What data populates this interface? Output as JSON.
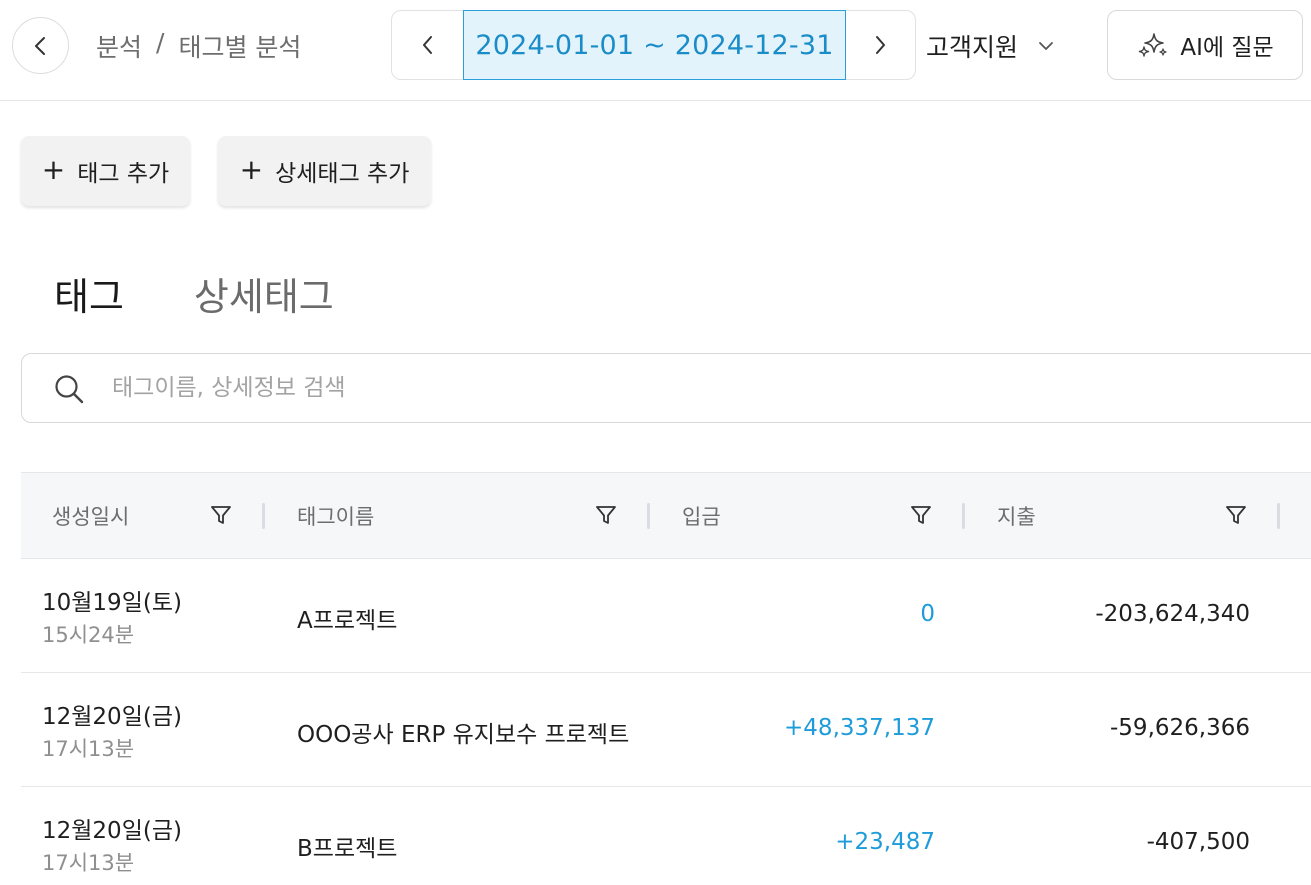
{
  "breadcrumb": {
    "parent": "분석",
    "separator": "/",
    "current": "태그별 분석"
  },
  "date_range": {
    "label": "2024-01-01 ~ 2024-12-31"
  },
  "org_select": {
    "value": "고객지원"
  },
  "ai_button": {
    "label": "AI에 질문"
  },
  "actions": {
    "add_tag": "태그 추가",
    "add_detail_tag": "상세태그 추가"
  },
  "tabs": {
    "tag": "태그",
    "detail_tag": "상세태그",
    "active": "tag"
  },
  "search": {
    "placeholder": "태그이름, 상세정보 검색",
    "value": ""
  },
  "table": {
    "columns": {
      "created": "생성일시",
      "name": "태그이름",
      "income": "입금",
      "expense": "지출"
    },
    "rows": [
      {
        "date": "10월19일(토)",
        "time": "15시24분",
        "name": "A프로젝트",
        "income": "0",
        "expense": "-203,624,340"
      },
      {
        "date": "12월20일(금)",
        "time": "17시13분",
        "name": "OOO공사 ERP 유지보수 프로젝트",
        "income": "+48,337,137",
        "expense": "-59,626,366"
      },
      {
        "date": "12월20일(금)",
        "time": "17시13분",
        "name": "B프로젝트",
        "income": "+23,487",
        "expense": "-407,500"
      }
    ]
  },
  "colors": {
    "accent": "#1e9bd9",
    "date_bg": "#e3f3fc",
    "header_bg": "#f6f7f9"
  }
}
